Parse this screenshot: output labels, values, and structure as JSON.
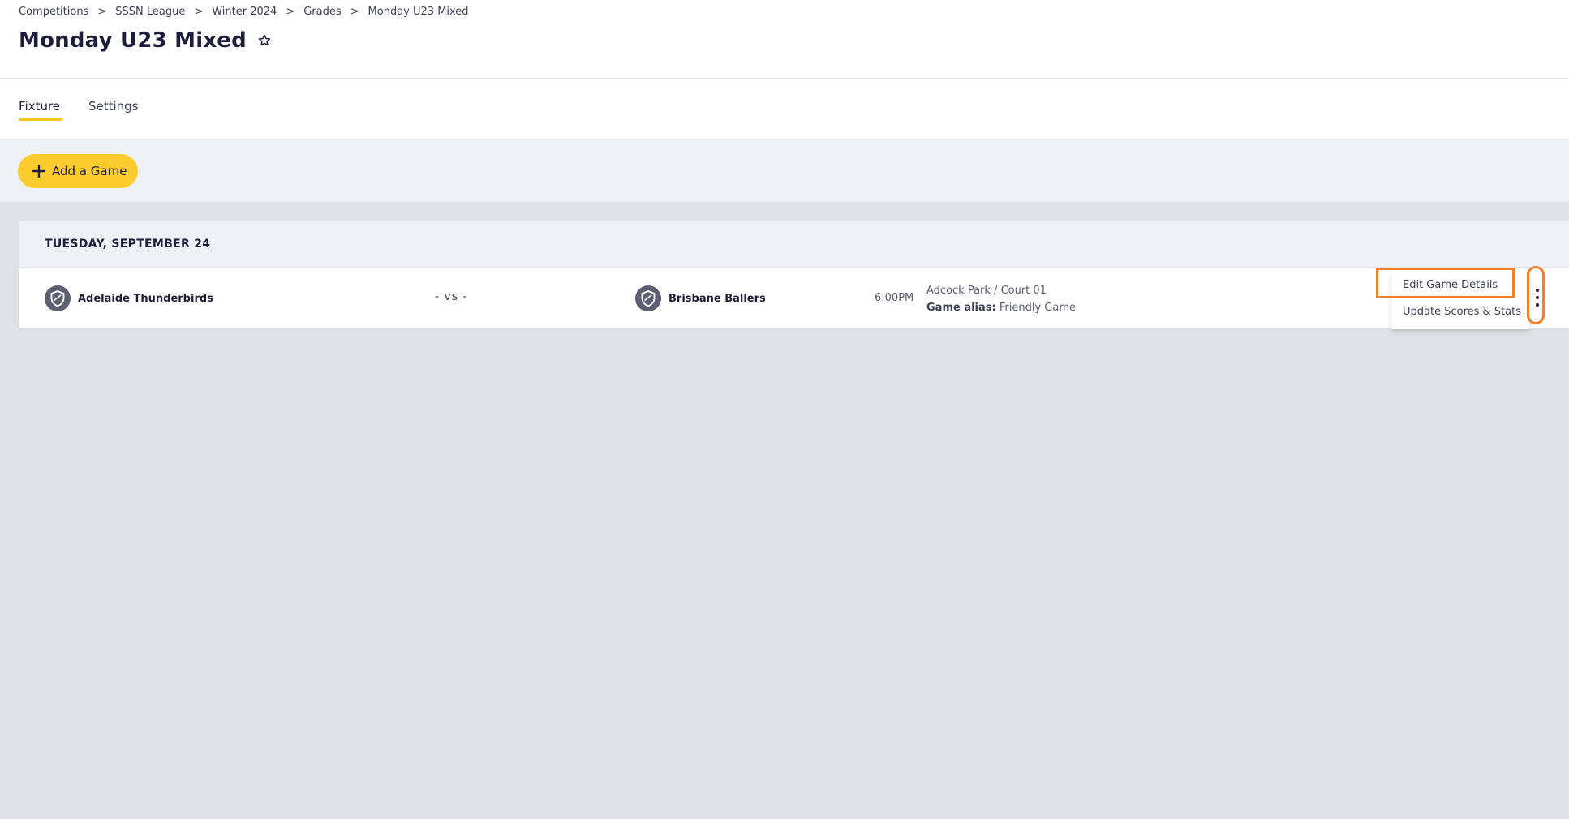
{
  "breadcrumb": {
    "items": [
      "Competitions",
      "SSSN League",
      "Winter 2024",
      "Grades",
      "Monday U23 Mixed"
    ],
    "separator": ">"
  },
  "page": {
    "title": "Monday U23 Mixed",
    "favorite_icon": "star-outline-icon"
  },
  "tabs": [
    {
      "label": "Fixture",
      "active": true
    },
    {
      "label": "Settings",
      "active": false
    }
  ],
  "toolbar": {
    "add_game_label": "Add a Game",
    "add_icon": "plus-icon"
  },
  "fixture": {
    "date_label": "TUESDAY, SEPTEMBER 24",
    "games": [
      {
        "home_team": "Adelaide Thunderbirds",
        "away_team": "Brisbane Ballers",
        "score_separator": "- vs -",
        "time": "6:00PM",
        "venue": "Adcock Park / Court 01",
        "alias_label": "Game alias:",
        "alias_value": "Friendly Game",
        "team_icon": "shield-logo-icon"
      }
    ]
  },
  "game_menu": {
    "items": [
      "Edit Game Details",
      "Update Scores & Stats"
    ],
    "trigger_icon": "more-vertical-icon"
  },
  "colors": {
    "accent": "#fccb2e",
    "highlight": "#f27f2c",
    "text_primary": "#1f1d3a",
    "panel_bg": "#eef1f6",
    "page_bg": "#dee1e6"
  }
}
